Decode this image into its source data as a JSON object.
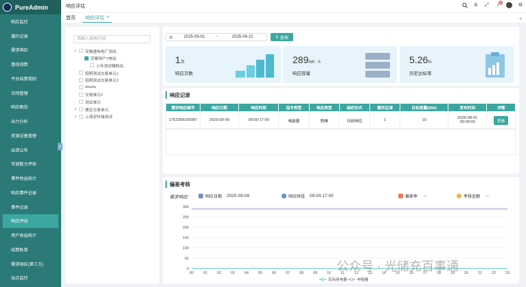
{
  "app": {
    "name": "PureAdmin"
  },
  "sidebar": {
    "items": [
      {
        "label": "响应监控"
      },
      {
        "label": "邀约记录"
      },
      {
        "label": "需求响应"
      },
      {
        "label": "基线测算"
      },
      {
        "label": "平台结算规则"
      },
      {
        "label": "合同管理"
      },
      {
        "label": "响应概览"
      },
      {
        "label": "出力分析"
      },
      {
        "label": "资源设备管理"
      },
      {
        "label": "出清公布"
      },
      {
        "label": "可调能力评估"
      },
      {
        "label": "事件收益统计"
      },
      {
        "label": "响应事件记录"
      },
      {
        "label": "事件记录"
      },
      {
        "label": "响应评估"
      },
      {
        "label": "用户收益统计"
      },
      {
        "label": "结算账单"
      },
      {
        "label": "需求响应(第三方)"
      },
      {
        "label": "站点监控"
      }
    ],
    "active_index": 14
  },
  "topbar": {
    "breadcrumb": "响应评估",
    "notification_count": "2"
  },
  "tabs": {
    "home": "首页",
    "active": "响应评估"
  },
  "tree": {
    "search_placeholder": "请输入搜索内容",
    "nodes": [
      {
        "label": "安徽虚拟电厂测试",
        "level": 0,
        "expandable": true,
        "checked": false
      },
      {
        "label": "安徽用户2电站",
        "level": 1,
        "expandable": false,
        "checked": true
      },
      {
        "label": "上传测试辅助站",
        "level": 2,
        "expandable": false,
        "checked": false
      },
      {
        "label": "昭明测试交易单元1",
        "level": 0,
        "expandable": false,
        "checked": false
      },
      {
        "label": "昭明测试交易单元2",
        "level": 0,
        "expandable": false,
        "checked": false
      },
      {
        "label": "dasda",
        "level": 0,
        "expandable": false,
        "checked": false
      },
      {
        "label": "交易单元2",
        "level": 0,
        "expandable": false,
        "checked": false
      },
      {
        "label": "测试单元",
        "level": 0,
        "expandable": false,
        "checked": false
      },
      {
        "label": "鹿定交易单元",
        "level": 0,
        "expandable": true,
        "checked": false
      },
      {
        "label": "上海安科瑞测试",
        "level": 0,
        "expandable": true,
        "checked": false
      }
    ]
  },
  "filter": {
    "start_date": "2025-09-01",
    "end_date": "2025-09-22",
    "separator": "~",
    "query_label": "查询"
  },
  "stats": [
    {
      "value": "1",
      "unit": "次",
      "label": "响应次数"
    },
    {
      "value": "289",
      "unit": "kW · h",
      "label": "响应容量"
    },
    {
      "value": "5.26",
      "unit": "%",
      "label": "历史达标率"
    }
  ],
  "records": {
    "title": "响应记录",
    "columns": [
      "需求响应编号",
      "响应日期",
      "响应时段",
      "指令类型",
      "响应类型",
      "组织形式",
      "需求区域",
      "目标容量(MW)",
      "发布时间",
      "详情"
    ],
    "rows": [
      {
        "id": "1753259155087",
        "date": "2025-09-09",
        "period": "09:00-17:00",
        "cmd": "电能量",
        "type": "削峰",
        "form": "日前响应",
        "area": "1",
        "capacity": "10",
        "publish_date": "2025-08-01",
        "publish_time": "00:00:00",
        "action": "查看"
      }
    ]
  },
  "deviation": {
    "title": "偏差考核",
    "demand_label": "需求响应:",
    "date_label": "响应日期",
    "date_value": "2025-09-09",
    "period_label": "响应时段",
    "period_value": "09:00-17:00",
    "deviation_label": "偏差率",
    "deviation_value": "--",
    "assess_label": "考核金额",
    "assess_value": "--"
  },
  "chart_data": {
    "type": "line",
    "x": [
      "00",
      "01",
      "02",
      "03",
      "04",
      "05",
      "06",
      "07",
      "08",
      "09",
      "10",
      "11",
      "12",
      "13",
      "14",
      "15",
      "16",
      "17",
      "18",
      "19",
      "20",
      "21",
      "22",
      "23"
    ],
    "yticks": [
      0,
      50,
      100,
      150,
      200,
      250,
      300
    ],
    "ylim": [
      0,
      300
    ],
    "series": [
      {
        "name": "实际用电量",
        "color": "#4ac6c0",
        "values": [
          0,
          0,
          0,
          0,
          0,
          0,
          0,
          0,
          0,
          0,
          0,
          0,
          0,
          0,
          0,
          0,
          0,
          0,
          0,
          0,
          0,
          0,
          0,
          0
        ]
      },
      {
        "name": "申报量",
        "color": "#9b8fd6",
        "values": [
          289,
          289,
          289,
          289,
          289,
          289,
          289,
          289,
          289,
          289,
          289,
          289,
          289,
          289,
          289,
          289,
          289,
          289,
          289,
          289,
          289,
          289,
          289,
          289
        ]
      }
    ],
    "legend_position": "bottom"
  },
  "watermark": "公众号 · 光储充百事通"
}
